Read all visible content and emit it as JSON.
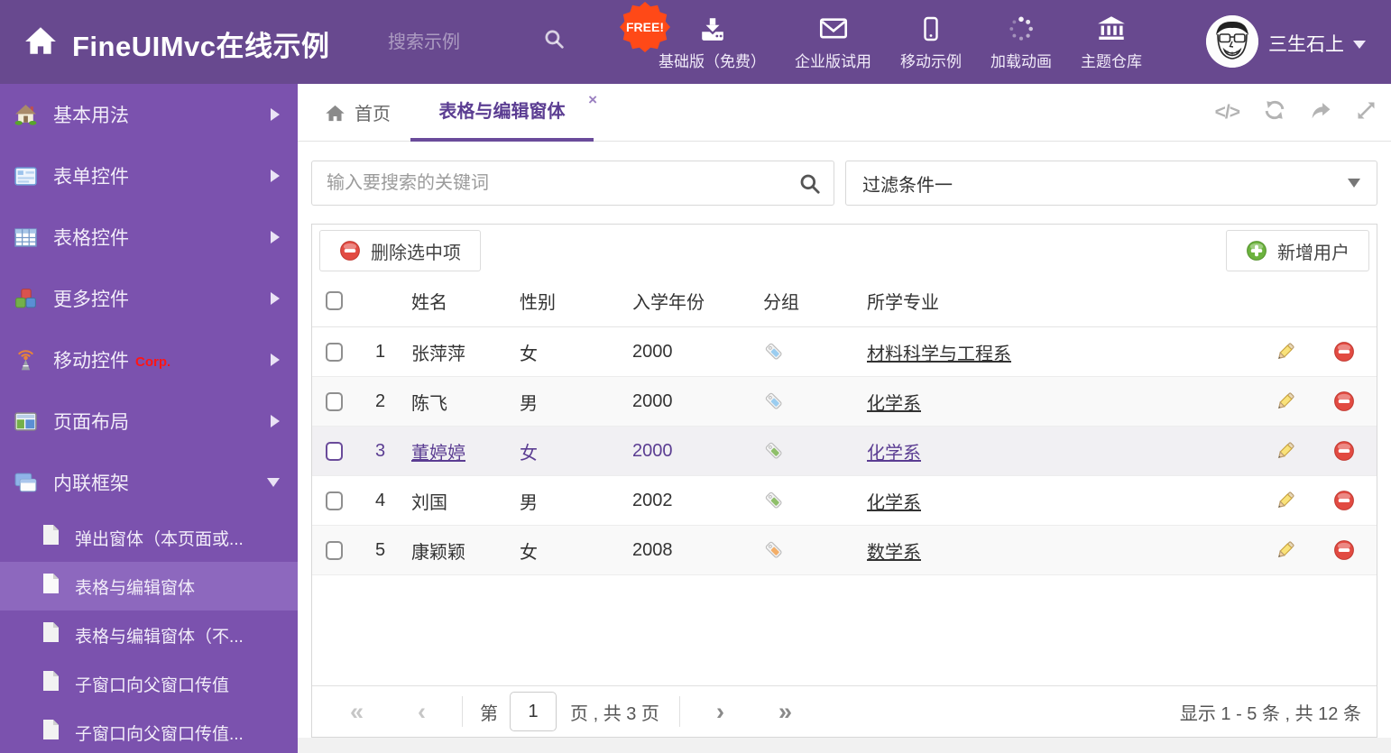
{
  "colors": {
    "header_bg": "#68498f",
    "sidebar_bg": "#7b52ae",
    "accent_purple": "#6a4b9a",
    "free_badge_orange": "#ff4917",
    "delete_red": "#e24b42",
    "add_green": "#6cb33e",
    "tag_blue": "#9bcdf0",
    "tag_green": "#8fbf6a",
    "tag_orange": "#f3ae68",
    "selected_row_bg": "#f1f0f3"
  },
  "header": {
    "logo_text": "FineUIMvc在线示例",
    "search_placeholder": "搜索示例",
    "free_badge": "FREE!",
    "nav": [
      {
        "label": "基础版（免费）"
      },
      {
        "label": "企业版试用"
      },
      {
        "label": "移动示例"
      },
      {
        "label": "加载动画"
      },
      {
        "label": "主题仓库"
      }
    ],
    "user_name": "三生石上"
  },
  "sidebar": {
    "items": [
      {
        "label": "基本用法"
      },
      {
        "label": "表单控件"
      },
      {
        "label": "表格控件"
      },
      {
        "label": "更多控件"
      },
      {
        "label": "移动控件",
        "badge": "Corp."
      },
      {
        "label": "页面布局"
      },
      {
        "label": "内联框架"
      }
    ],
    "subitems": [
      {
        "label": "弹出窗体（本页面或..."
      },
      {
        "label": "表格与编辑窗体"
      },
      {
        "label": "表格与编辑窗体（不..."
      },
      {
        "label": "子窗口向父窗口传值"
      },
      {
        "label": "子窗口向父窗口传值..."
      }
    ]
  },
  "tabs": {
    "home": "首页",
    "active": "表格与编辑窗体",
    "close": "×"
  },
  "filters": {
    "keyword_placeholder": "输入要搜索的关键词",
    "filter_selected": "过滤条件一"
  },
  "toolbar": {
    "delete_selected": "删除选中项",
    "add_user": "新增用户"
  },
  "table": {
    "headers": {
      "name": "姓名",
      "gender": "性别",
      "year": "入学年份",
      "group": "分组",
      "major": "所学专业"
    },
    "rows": [
      {
        "num": "1",
        "name": "张萍萍",
        "gender": "女",
        "year": "2000",
        "tag_color": "#9bcdf0",
        "major": "材料科学与工程系"
      },
      {
        "num": "2",
        "name": "陈飞",
        "gender": "男",
        "year": "2000",
        "tag_color": "#9bcdf0",
        "major": "化学系"
      },
      {
        "num": "3",
        "name": "董婷婷",
        "gender": "女",
        "year": "2000",
        "tag_color": "#8fbf6a",
        "major": "化学系"
      },
      {
        "num": "4",
        "name": "刘国",
        "gender": "男",
        "year": "2002",
        "tag_color": "#8fbf6a",
        "major": "化学系"
      },
      {
        "num": "5",
        "name": "康颖颖",
        "gender": "女",
        "year": "2008",
        "tag_color": "#f3ae68",
        "major": "数学系"
      }
    ]
  },
  "pagination": {
    "page_label_prefix": "第",
    "page_value": "1",
    "page_label_suffix": "页 , 共 3 页",
    "summary": "显示 1 - 5 条 , 共 12 条"
  }
}
